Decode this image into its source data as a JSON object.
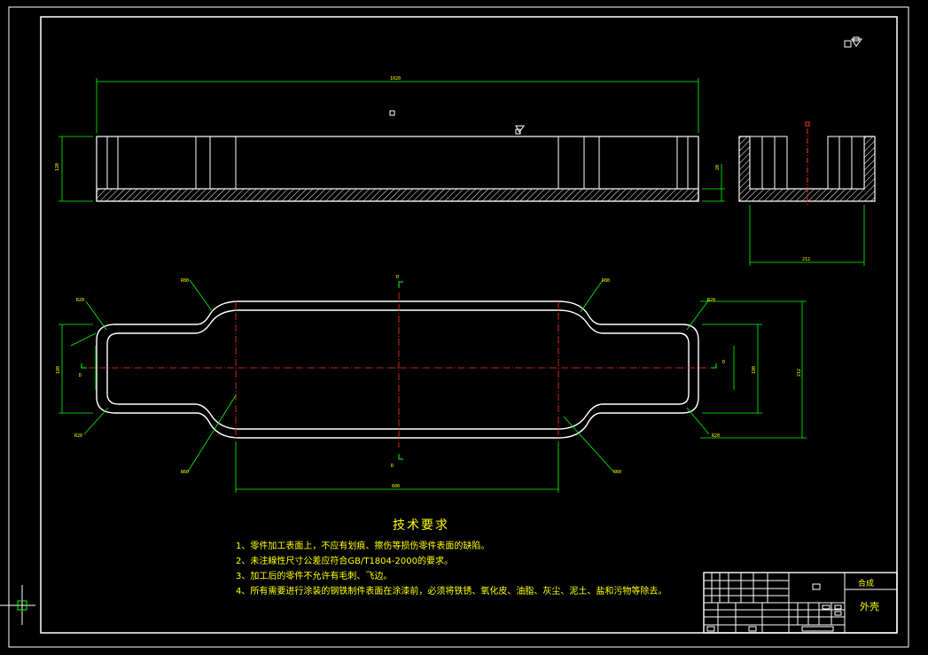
{
  "drawing": {
    "colors": {
      "background": "#000000",
      "outline": "#ffffff",
      "dimension": "#00ff00",
      "centerline": "#ff3030",
      "text": "#ffff00"
    },
    "dimensions": {
      "top_length": "1020",
      "height_left": "120",
      "base_right": "20",
      "side_width": "212",
      "plan_center_length": "600",
      "plan_width_right": "212",
      "plan_end_left": "180",
      "plan_end_right": "180",
      "r_left_top": "R20",
      "r_left_bottom": "R20",
      "r_mid_top_left": "R80",
      "r_mid_top_right": "R80",
      "r_mid_bottom_left": "R60",
      "r_mid_bottom_right": "R60",
      "r_right_top": "R20",
      "r_right_bottom": "R20"
    },
    "section_marks": {
      "top": "D",
      "bottom": "D",
      "left": "D",
      "right": "D"
    }
  },
  "tech": {
    "title": "技术要求",
    "notes": [
      "1、零件加工表面上，不应有划痕、擦伤等损伤零件表面的缺陷。",
      "2、未注線性尺寸公差应符合GB/T1804-2000的要求。",
      "3、加工后的零件不允许有毛刺、飞边。",
      "4、所有需要进行涂装的钢铁制件表面在涂漆前，必须将铁锈、氧化皮、油脂、灰尘、泥土、盐和污物等除去。"
    ]
  },
  "title_block": {
    "material": "合成",
    "part_name": "外壳"
  }
}
